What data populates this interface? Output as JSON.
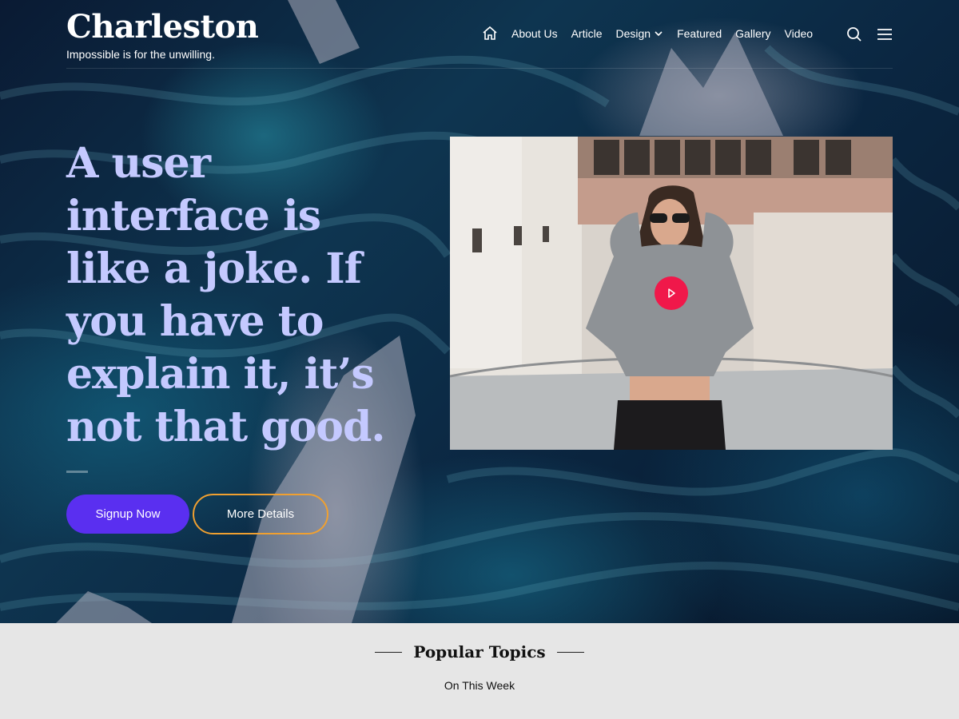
{
  "site": {
    "title": "Charleston",
    "tagline": "Impossible is for the unwilling."
  },
  "nav": {
    "home_icon": "home-icon",
    "items": [
      {
        "label": "About Us"
      },
      {
        "label": "Article"
      },
      {
        "label": "Design",
        "has_dropdown": true
      },
      {
        "label": "Featured"
      },
      {
        "label": "Gallery"
      },
      {
        "label": "Video"
      }
    ],
    "search_icon": "search-icon",
    "menu_icon": "hamburger-menu-icon"
  },
  "hero": {
    "headline": "A user interface is like a joke. If you have to explain it, it’s not that good.",
    "primary_button": "Signup Now",
    "secondary_button": "More Details",
    "video": {
      "play_icon": "play-icon"
    }
  },
  "popular": {
    "title": "Popular Topics",
    "subtitle": "On This Week"
  },
  "colors": {
    "headline": "#c4c9ff",
    "primary_button": "#5a2ff0",
    "secondary_border": "#f0a030",
    "play_button": "#f0184a",
    "topics_bg": "#e6e6e6"
  }
}
